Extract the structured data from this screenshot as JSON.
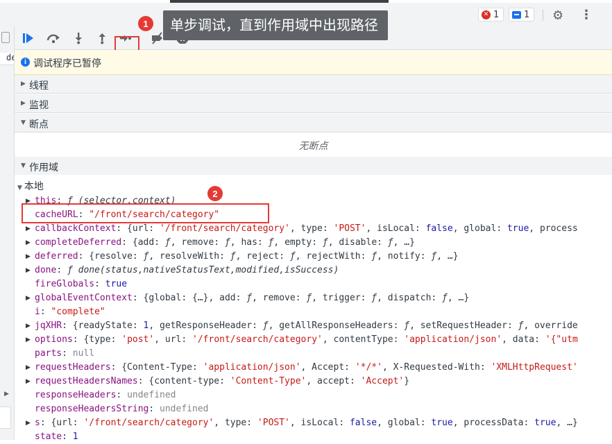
{
  "tooltip": {
    "text": "单步调试，直到作用域中出现路径"
  },
  "annotations": {
    "one": "1",
    "two": "2"
  },
  "topbar": {
    "errors_count": "1",
    "messages_count": "1",
    "icons": [
      "error-icon",
      "message-icon",
      "gear-icon",
      "more-vertical-icon"
    ]
  },
  "left_panel": {
    "tab_label": "de"
  },
  "debug_toolbar": {
    "buttons": [
      "resume-icon",
      "step-over-icon",
      "step-into-icon",
      "step-out-icon",
      "step-icon",
      "deactivate-breakpoints-icon",
      "pause-on-exceptions-icon"
    ]
  },
  "banner": {
    "text": "调试程序已暂停"
  },
  "sections": {
    "threads": "线程",
    "watch": "监视",
    "breakpoints": "断点",
    "no_breakpoints": "无断点",
    "scope": "作用域"
  },
  "scope": {
    "local_label": "本地",
    "rows": [
      {
        "expandable": true,
        "parts": [
          [
            "k",
            "this"
          ],
          [
            "p",
            ": "
          ],
          [
            "it",
            "ƒ (selector,context)"
          ]
        ]
      },
      {
        "expandable": false,
        "parts": [
          [
            "k",
            "cacheURL"
          ],
          [
            "p",
            ": "
          ],
          [
            "s",
            "\"/front/search/category\""
          ]
        ]
      },
      {
        "expandable": true,
        "parts": [
          [
            "k",
            "callbackContext"
          ],
          [
            "p",
            ": {url: "
          ],
          [
            "s",
            "'/front/search/category'"
          ],
          [
            "p",
            ", type: "
          ],
          [
            "s",
            "'POST'"
          ],
          [
            "p",
            ", isLocal: "
          ],
          [
            "n",
            "false"
          ],
          [
            "p",
            ", global: "
          ],
          [
            "n",
            "true"
          ],
          [
            "p",
            ", process"
          ]
        ]
      },
      {
        "expandable": true,
        "parts": [
          [
            "k",
            "completeDeferred"
          ],
          [
            "p",
            ": {add: "
          ],
          [
            "it",
            "ƒ"
          ],
          [
            "p",
            ", remove: "
          ],
          [
            "it",
            "ƒ"
          ],
          [
            "p",
            ", has: "
          ],
          [
            "it",
            "ƒ"
          ],
          [
            "p",
            ", empty: "
          ],
          [
            "it",
            "ƒ"
          ],
          [
            "p",
            ", disable: "
          ],
          [
            "it",
            "ƒ"
          ],
          [
            "p",
            ", …}"
          ]
        ]
      },
      {
        "expandable": true,
        "parts": [
          [
            "k",
            "deferred"
          ],
          [
            "p",
            ": {resolve: "
          ],
          [
            "it",
            "ƒ"
          ],
          [
            "p",
            ", resolveWith: "
          ],
          [
            "it",
            "ƒ"
          ],
          [
            "p",
            ", reject: "
          ],
          [
            "it",
            "ƒ"
          ],
          [
            "p",
            ", rejectWith: "
          ],
          [
            "it",
            "ƒ"
          ],
          [
            "p",
            ", notify: "
          ],
          [
            "it",
            "ƒ"
          ],
          [
            "p",
            ", …}"
          ]
        ]
      },
      {
        "expandable": true,
        "parts": [
          [
            "k",
            "done"
          ],
          [
            "p",
            ": "
          ],
          [
            "it",
            "ƒ done(status,nativeStatusText,modified,isSuccess)"
          ]
        ]
      },
      {
        "expandable": false,
        "parts": [
          [
            "k",
            "fireGlobals"
          ],
          [
            "p",
            ": "
          ],
          [
            "n",
            "true"
          ]
        ]
      },
      {
        "expandable": true,
        "parts": [
          [
            "k",
            "globalEventContext"
          ],
          [
            "p",
            ": {global: {…}, add: "
          ],
          [
            "it",
            "ƒ"
          ],
          [
            "p",
            ", remove: "
          ],
          [
            "it",
            "ƒ"
          ],
          [
            "p",
            ", trigger: "
          ],
          [
            "it",
            "ƒ"
          ],
          [
            "p",
            ", dispatch: "
          ],
          [
            "it",
            "ƒ"
          ],
          [
            "p",
            ", …}"
          ]
        ]
      },
      {
        "expandable": false,
        "parts": [
          [
            "k",
            "i"
          ],
          [
            "p",
            ": "
          ],
          [
            "s",
            "\"complete\""
          ]
        ]
      },
      {
        "expandable": true,
        "parts": [
          [
            "k",
            "jqXHR"
          ],
          [
            "p",
            ": {readyState: "
          ],
          [
            "n",
            "1"
          ],
          [
            "p",
            ", getResponseHeader: "
          ],
          [
            "it",
            "ƒ"
          ],
          [
            "p",
            ", getAllResponseHeaders: "
          ],
          [
            "it",
            "ƒ"
          ],
          [
            "p",
            ", setRequestHeader: "
          ],
          [
            "it",
            "ƒ"
          ],
          [
            "p",
            ", override"
          ]
        ]
      },
      {
        "expandable": true,
        "parts": [
          [
            "k",
            "options"
          ],
          [
            "p",
            ": {type: "
          ],
          [
            "s",
            "'post'"
          ],
          [
            "p",
            ", url: "
          ],
          [
            "s",
            "'/front/search/category'"
          ],
          [
            "p",
            ", contentType: "
          ],
          [
            "s",
            "'application/json'"
          ],
          [
            "p",
            ", data: "
          ],
          [
            "s",
            "'{\"utm"
          ]
        ]
      },
      {
        "expandable": false,
        "parts": [
          [
            "k",
            "parts"
          ],
          [
            "p",
            ": "
          ],
          [
            "g",
            "null"
          ]
        ]
      },
      {
        "expandable": true,
        "parts": [
          [
            "k",
            "requestHeaders"
          ],
          [
            "p",
            ": {Content-Type: "
          ],
          [
            "s",
            "'application/json'"
          ],
          [
            "p",
            ", Accept: "
          ],
          [
            "s",
            "'*/*'"
          ],
          [
            "p",
            ", X-Requested-With: "
          ],
          [
            "s",
            "'XMLHttpRequest'"
          ]
        ]
      },
      {
        "expandable": true,
        "parts": [
          [
            "k",
            "requestHeadersNames"
          ],
          [
            "p",
            ": {content-type: "
          ],
          [
            "s",
            "'Content-Type'"
          ],
          [
            "p",
            ", accept: "
          ],
          [
            "s",
            "'Accept'"
          ],
          [
            "p",
            "}"
          ]
        ]
      },
      {
        "expandable": false,
        "parts": [
          [
            "k",
            "responseHeaders"
          ],
          [
            "p",
            ": "
          ],
          [
            "g",
            "undefined"
          ]
        ]
      },
      {
        "expandable": false,
        "parts": [
          [
            "k",
            "responseHeadersString"
          ],
          [
            "p",
            ": "
          ],
          [
            "g",
            "undefined"
          ]
        ]
      },
      {
        "expandable": true,
        "parts": [
          [
            "k",
            "s"
          ],
          [
            "p",
            ": {url: "
          ],
          [
            "s",
            "'/front/search/category'"
          ],
          [
            "p",
            ", type: "
          ],
          [
            "s",
            "'POST'"
          ],
          [
            "p",
            ", isLocal: "
          ],
          [
            "n",
            "false"
          ],
          [
            "p",
            ", global: "
          ],
          [
            "n",
            "true"
          ],
          [
            "p",
            ", processData: "
          ],
          [
            "n",
            "true"
          ],
          [
            "p",
            ", …}"
          ]
        ]
      },
      {
        "expandable": false,
        "parts": [
          [
            "k",
            "state"
          ],
          [
            "p",
            ": "
          ],
          [
            "n",
            "1"
          ]
        ]
      }
    ]
  },
  "colors": {
    "annotation_red": "#e53935",
    "property_name": "#881280",
    "string_value": "#c41a16",
    "keyword_value": "#1a1aa6",
    "banner_bg": "#fffbe6"
  }
}
